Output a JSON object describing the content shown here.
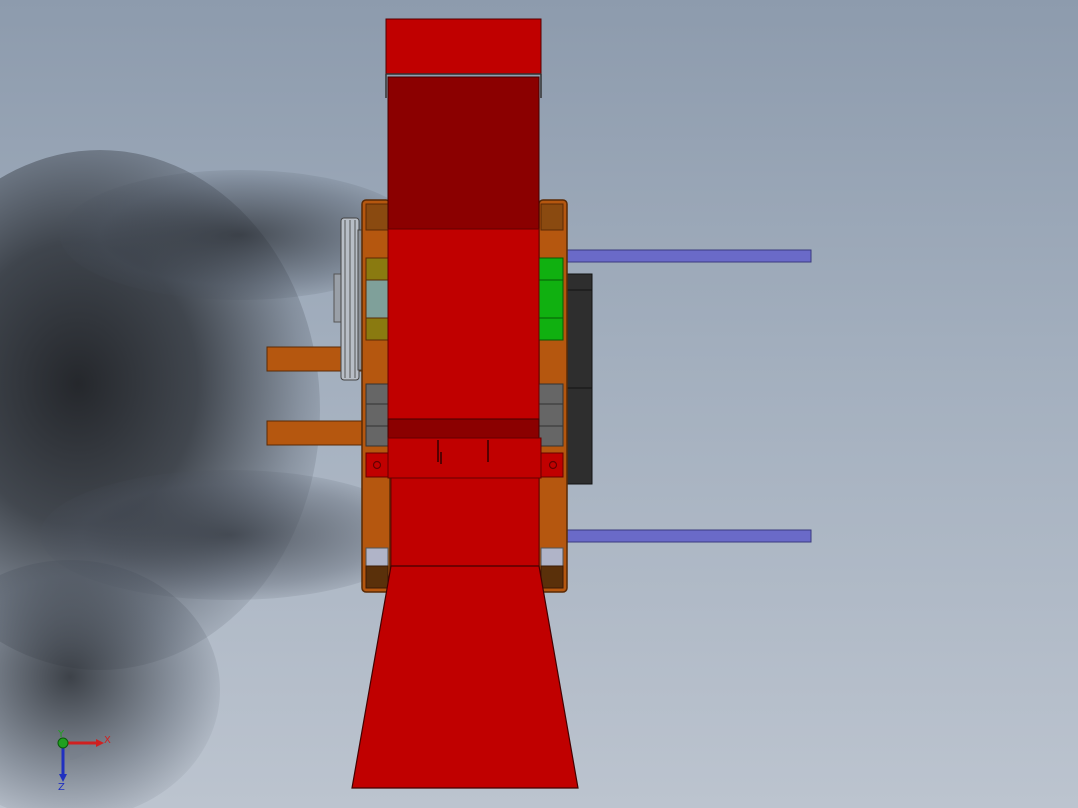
{
  "view": {
    "background_top": "#8d9bad",
    "background_bottom": "#bcc4cf"
  },
  "colors": {
    "red": "#c00000",
    "dark_red": "#8b0000",
    "orange_brown": "#b5570f",
    "olive": "#8a7a10",
    "green": "#10b010",
    "grey": "#666666",
    "black_block": "#2e2e2e",
    "rod_blue": "#6a6ac8",
    "pulley_grey": "#9aa0a8"
  },
  "triad": {
    "x_label": "X",
    "y_label": "Y",
    "z_label": "Z",
    "x_color": "#d02020",
    "y_color": "#20a020",
    "z_color": "#2030c0"
  }
}
